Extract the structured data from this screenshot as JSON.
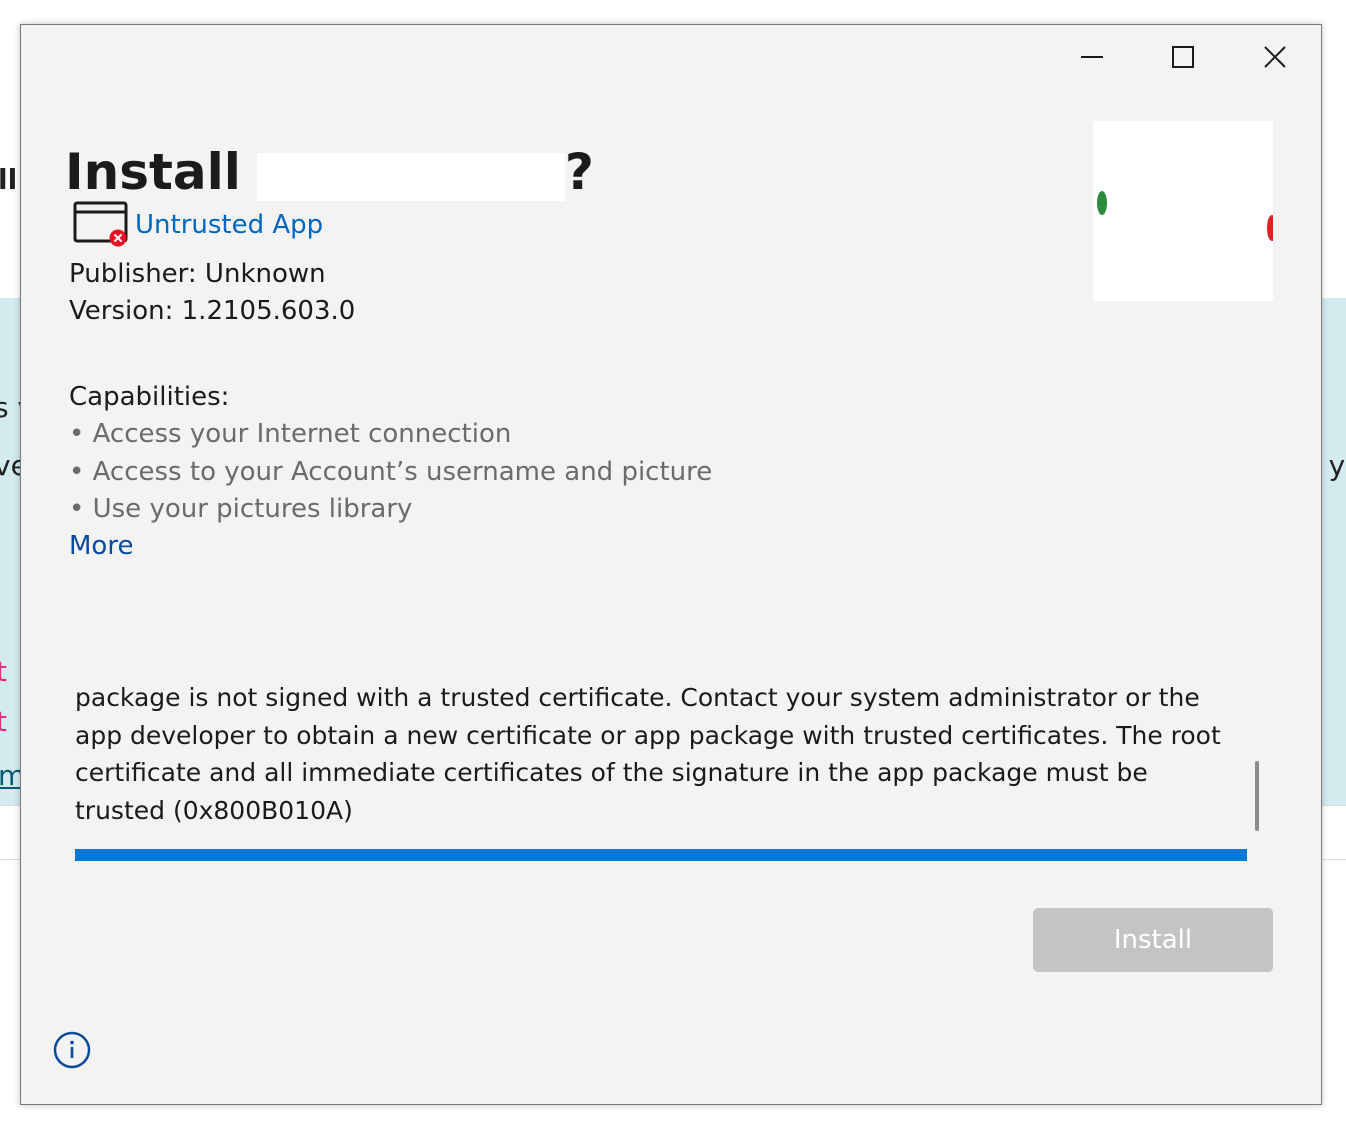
{
  "background_app": {
    "fragments": [
      "ll",
      "s v",
      "ve",
      "n y",
      "t",
      "t",
      "m"
    ]
  },
  "window_controls": {
    "minimize_icon": "minimize-icon",
    "maximize_icon": "maximize-icon",
    "close_icon": "close-icon"
  },
  "dialog": {
    "title_prefix": "Install",
    "title_suffix": "?",
    "untrusted_label": "Untrusted App",
    "untrusted_icon": "untrusted-app-icon",
    "publisher": "Publisher: Unknown",
    "version": "Version: 1.2105.603.0",
    "capabilities_heading": "Capabilities:",
    "capabilities": [
      "• Access your Internet connection",
      "• Access to your Account’s username and picture",
      "• Use your pictures library"
    ],
    "more_label": "More",
    "error_message": "package is not signed with a trusted certificate. Contact your system administrator or the app developer to obtain a new certificate or app package with trusted certificates. The root certificate and all immediate certificates of the signature in the app package must be trusted (0x800B010A)",
    "progress": 1.0,
    "install_label": "Install",
    "info_icon": "info-icon"
  },
  "colors": {
    "accent": "#0078d4",
    "link": "#0067c0",
    "more_link": "#0a4a9e",
    "error_badge": "#e81123",
    "dialog_bg": "#f3f3f3",
    "disabled_button": "#c4c4c4"
  }
}
